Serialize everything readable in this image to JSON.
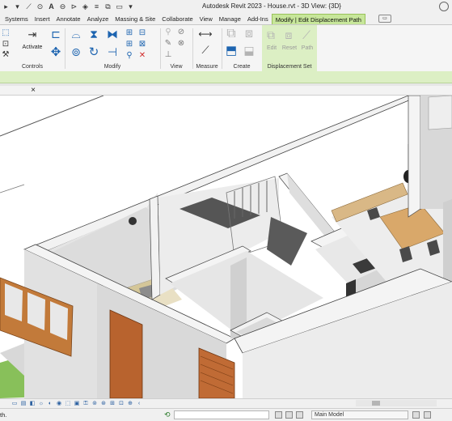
{
  "app": {
    "title": "Autodesk Revit 2023 - House.rvt - 3D View: {3D}"
  },
  "tabs": [
    {
      "label": "Systems"
    },
    {
      "label": "Insert"
    },
    {
      "label": "Annotate"
    },
    {
      "label": "Analyze"
    },
    {
      "label": "Massing & Site"
    },
    {
      "label": "Collaborate"
    },
    {
      "label": "View"
    },
    {
      "label": "Manage"
    },
    {
      "label": "Add-Ins"
    },
    {
      "label": "Modify | Edit Displacement Path"
    }
  ],
  "ribbon": {
    "activate_label": "Activate",
    "edit_label": "Edit",
    "reset_label": "Reset",
    "path_label": "Path",
    "panels": {
      "controls": "Controls",
      "modify": "Modify",
      "view": "View",
      "measure": "Measure",
      "create": "Create",
      "displacement_set": "Displacement Set"
    }
  },
  "view_tab": {
    "close_glyph": "×"
  },
  "status": {
    "left_text": "th.",
    "model": "Main Model"
  },
  "colors": {
    "accent_green": "#c7e69a",
    "ribbon_blue": "#1d64b0",
    "wall_top": "#f2f2f2",
    "wall_side": "#d9d9d9",
    "floor_wood": "#caa16a",
    "door_wood": "#b8632e"
  },
  "icons": [
    "open-icon",
    "save-icon",
    "sync-icon",
    "undo-icon",
    "redo-icon",
    "measure-icon",
    "tag-icon",
    "text-icon",
    "3d-view-icon",
    "section-icon",
    "thin-lines-icon",
    "close-hidden-icon",
    "switch-windows-icon",
    "modify-arrow-icon",
    "activate-icon",
    "align-icon",
    "offset-icon",
    "mirror-icon",
    "move-icon",
    "copy-icon",
    "rotate-icon",
    "trim-icon",
    "split-icon",
    "array-icon",
    "scale-icon",
    "pin-icon",
    "delete-icon",
    "hide-icon",
    "override-icon",
    "measure-distance-icon",
    "create-group-icon",
    "create-assembly-icon"
  ]
}
